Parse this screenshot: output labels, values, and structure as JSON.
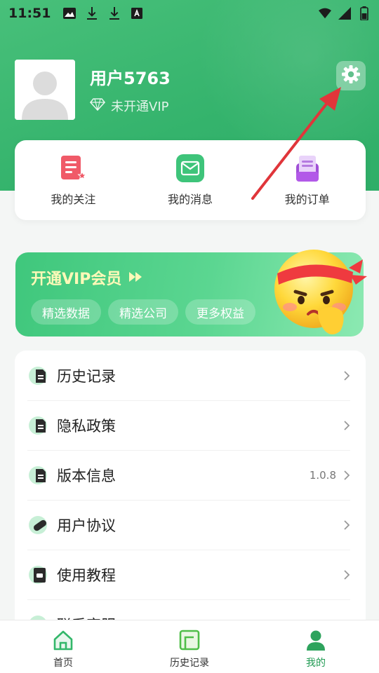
{
  "status_bar": {
    "time": "11:51",
    "left_icons": [
      "image-icon",
      "download-icon",
      "download-icon",
      "keyboard-a-icon"
    ],
    "right_icons": [
      "wifi-icon",
      "signal-icon",
      "battery-icon"
    ]
  },
  "profile": {
    "username": "用户5763",
    "vip_status": "未开通VIP"
  },
  "quick_actions": [
    {
      "label": "我的关注",
      "icon": "follow-doc-icon"
    },
    {
      "label": "我的消息",
      "icon": "message-envelope-icon"
    },
    {
      "label": "我的订单",
      "icon": "order-clipboard-icon"
    }
  ],
  "vip_banner": {
    "title": "开通VIP会员",
    "chips": [
      "精选数据",
      "精选公司",
      "更多权益"
    ]
  },
  "menu": [
    {
      "label": "历史记录",
      "value": "",
      "icon": "document-icon"
    },
    {
      "label": "隐私政策",
      "value": "",
      "icon": "document-icon"
    },
    {
      "label": "版本信息",
      "value": "1.0.8",
      "icon": "document-icon"
    },
    {
      "label": "用户协议",
      "value": "",
      "icon": "pill-icon"
    },
    {
      "label": "使用教程",
      "value": "",
      "icon": "tutorial-icon"
    },
    {
      "label": "联系客服",
      "value": "",
      "icon": "eye-icon"
    }
  ],
  "bottom_nav": [
    {
      "label": "首页",
      "icon": "home-icon",
      "active": false
    },
    {
      "label": "历史记录",
      "icon": "history-icon",
      "active": false
    },
    {
      "label": "我的",
      "icon": "profile-icon",
      "active": true
    }
  ],
  "colors": {
    "brand_green": "#34b36c",
    "vip_title_yellow": "#fff9b8",
    "arrow_red": "#e0353a"
  }
}
